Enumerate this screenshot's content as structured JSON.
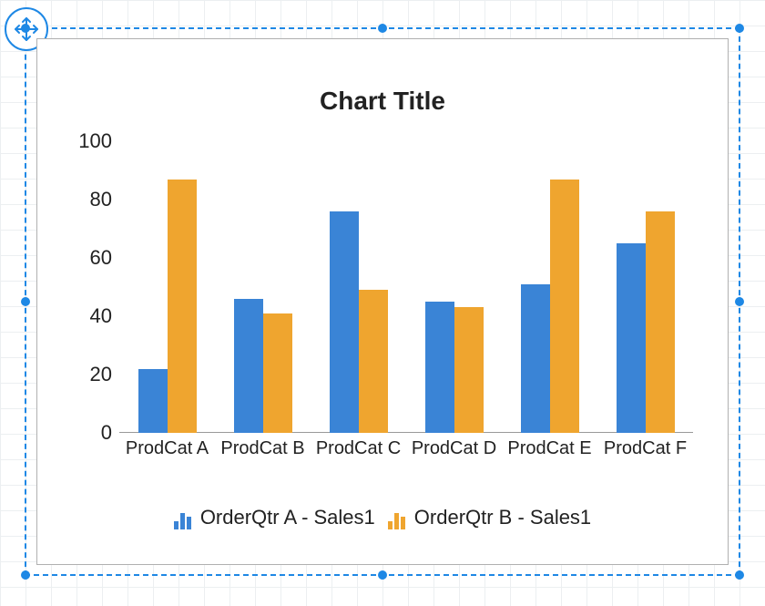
{
  "chart_data": {
    "type": "bar",
    "title": "Chart Title",
    "categories": [
      "ProdCat A",
      "ProdCat B",
      "ProdCat C",
      "ProdCat D",
      "ProdCat E",
      "ProdCat F"
    ],
    "series": [
      {
        "name": "OrderQtr A - Sales1",
        "color": "#3a84d6",
        "values": [
          22,
          46,
          76,
          45,
          51,
          65
        ]
      },
      {
        "name": "OrderQtr B - Sales1",
        "color": "#efa52f",
        "values": [
          87,
          41,
          49,
          43,
          87,
          76
        ]
      }
    ],
    "ylim": [
      0,
      100
    ],
    "y_ticks": [
      0,
      20,
      40,
      60,
      80,
      100
    ],
    "xlabel": "",
    "ylabel": ""
  },
  "designer": {
    "selection_color": "#1e88e5"
  }
}
